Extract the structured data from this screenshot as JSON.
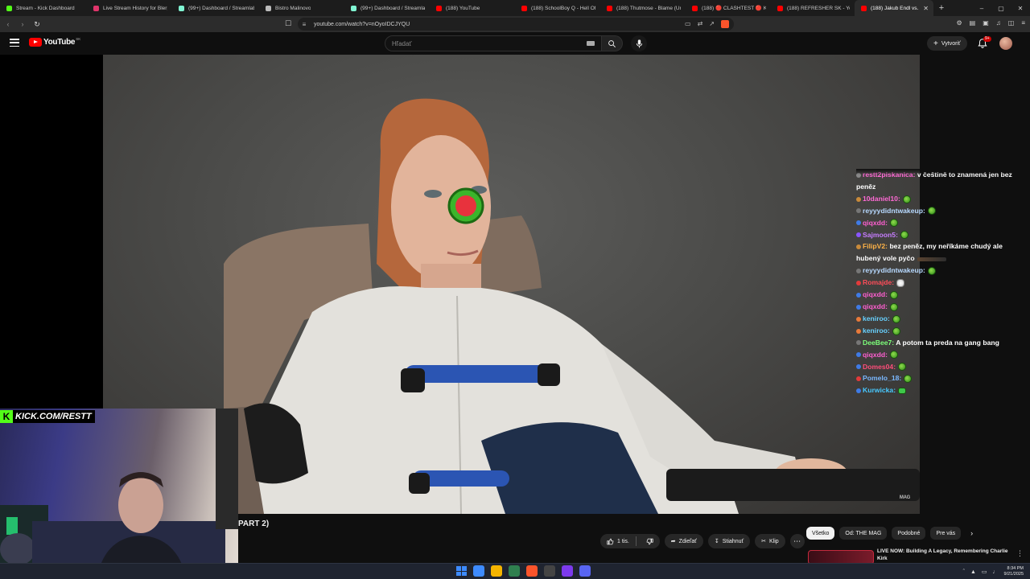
{
  "browser": {
    "tabs": [
      {
        "title": "Stream - Kick Dashboard",
        "color": "#53fc18",
        "width": 108
      },
      {
        "title": "Live Stream History for Blerp S",
        "color": "#e0356b",
        "width": 106
      },
      {
        "title": "(99+) Dashboard / Streamlabs",
        "color": "#80f5d2",
        "width": 108
      },
      {
        "title": "Bistro Malinovo",
        "color": "#bbbbbb",
        "width": 106
      },
      {
        "title": "(99+) Dashboard / Streamlabs",
        "color": "#80f5d2",
        "width": 106
      },
      {
        "title": "(188) YouTube",
        "color": "#ff0000",
        "width": 106
      },
      {
        "title": "(188) SchoolBoy Q - Hell Of A",
        "color": "#ff0000",
        "width": 106
      },
      {
        "title": "(188) Thutmose - Blame (Unof",
        "color": "#ff0000",
        "width": 106
      },
      {
        "title": "(188) 🔴 CLASHTEST 🔴 Kotin",
        "color": "#ff0000",
        "width": 106
      },
      {
        "title": "(188) REFRESHER SK - YouTube",
        "color": "#ff0000",
        "width": 104
      },
      {
        "title": "(188) Jakub Endl vs. Ve",
        "color": "#ff0000",
        "width": 98,
        "active": true
      }
    ],
    "new_tab": "+",
    "url": "youtube.com/watch?v=nOyoIDCJYQU",
    "window_controls": [
      "–",
      "▢",
      "✕"
    ]
  },
  "youtube": {
    "logo_text": "YouTube",
    "country_code": "SK",
    "search_placeholder": "Hľadať",
    "create_label": "Vytvoriť",
    "notif_badge": "9+"
  },
  "chat": {
    "messages": [
      {
        "user": "restt2piskanica:",
        "text": "v češtině to znamená jen bez peněz",
        "color": "#ff6ad5",
        "badge": "#888888",
        "wrap": true,
        "emote": ""
      },
      {
        "user": "10daniel10:",
        "text": "",
        "color": "#ff6ad5",
        "badge": "#c98a3a",
        "emote": "melon"
      },
      {
        "user": "reyyydidntwakeup:",
        "text": "",
        "color": "#b7d9ff",
        "badge": "#777777",
        "emote": "melon"
      },
      {
        "user": "qiqxdd:",
        "text": "",
        "color": "#ff5fd1",
        "badge": "#3f7be6",
        "emote": "melon"
      },
      {
        "user": "Sajmoon5:",
        "text": "",
        "color": "#c77dff",
        "badge": "#8a55ff",
        "emote": "melon"
      },
      {
        "user": "FilipV2:",
        "text": "bez peněz, my neříkáme chudý ale hubený vole pyčo",
        "color": "#ffb347",
        "badge": "#c98a3a",
        "wrap": true,
        "emote": "rifle"
      },
      {
        "user": "reyyydidntwakeup:",
        "text": "",
        "color": "#b7d9ff",
        "badge": "#777777",
        "emote": "melon"
      },
      {
        "user": "Romajde:",
        "text": "",
        "color": "#ff4d5a",
        "badge": "#e23a3a",
        "emote": "ghost"
      },
      {
        "user": "qiqxdd:",
        "text": "",
        "color": "#ff5fd1",
        "badge": "#3f7be6",
        "emote": "melon"
      },
      {
        "user": "qiqxdd:",
        "text": "",
        "color": "#ff5fd1",
        "badge": "#3f7be6",
        "emote": "melon"
      },
      {
        "user": "keniroo:",
        "text": "",
        "color": "#68d1ff",
        "badge": "#e87a3a",
        "emote": "melon"
      },
      {
        "user": "keniroo:",
        "text": "",
        "color": "#68d1ff",
        "badge": "#e87a3a",
        "emote": "melon"
      },
      {
        "user": "DeeBee7:",
        "text": "A potom ta preda na gang bang",
        "color": "#7dff7a",
        "badge": "#777777",
        "wrap": true,
        "emote": ""
      },
      {
        "user": "qiqxdd:",
        "text": "",
        "color": "#ff5fd1",
        "badge": "#3f7be6",
        "emote": "melon"
      },
      {
        "user": "Domes04:",
        "text": "",
        "color": "#ff4d7a",
        "badge": "#3f7be6",
        "emote": "melon"
      },
      {
        "user": "Pomelo_18:",
        "text": "",
        "color": "#7ab8ff",
        "badge": "#e23a3a",
        "emote": "melon"
      },
      {
        "user": "Kurwicka:",
        "text": "",
        "color": "#48c9ff",
        "badge": "#3f7be6",
        "emote": "frog"
      }
    ]
  },
  "overlay": {
    "cam_logo_letter": "K",
    "cam_logo_text": "KICK.COM/RESTT",
    "video_watermark": "MAG"
  },
  "video_info": {
    "title_fragment": "PART 2)",
    "likes": "1 tis.",
    "share_label": "Zdieľať",
    "download_label": "Stiahnuť",
    "clip_label": "Klip"
  },
  "related": {
    "chips": [
      {
        "label": "Všetko",
        "selected": true
      },
      {
        "label": "Od: THE MAG",
        "selected": false
      },
      {
        "label": "Podobné",
        "selected": false
      },
      {
        "label": "Pre vás",
        "selected": false
      }
    ],
    "first_video_title": "LIVE NOW: Building A Legacy, Remembering Charlie Kirk"
  },
  "taskbar": {
    "time": "8:34 PM",
    "date": "9/21/2025",
    "app_colors": [
      "#3d8bff",
      "#f4b400",
      "#2f7f4f",
      "#fb542b",
      "#444",
      "#7c3aed",
      "#5865f2"
    ]
  }
}
